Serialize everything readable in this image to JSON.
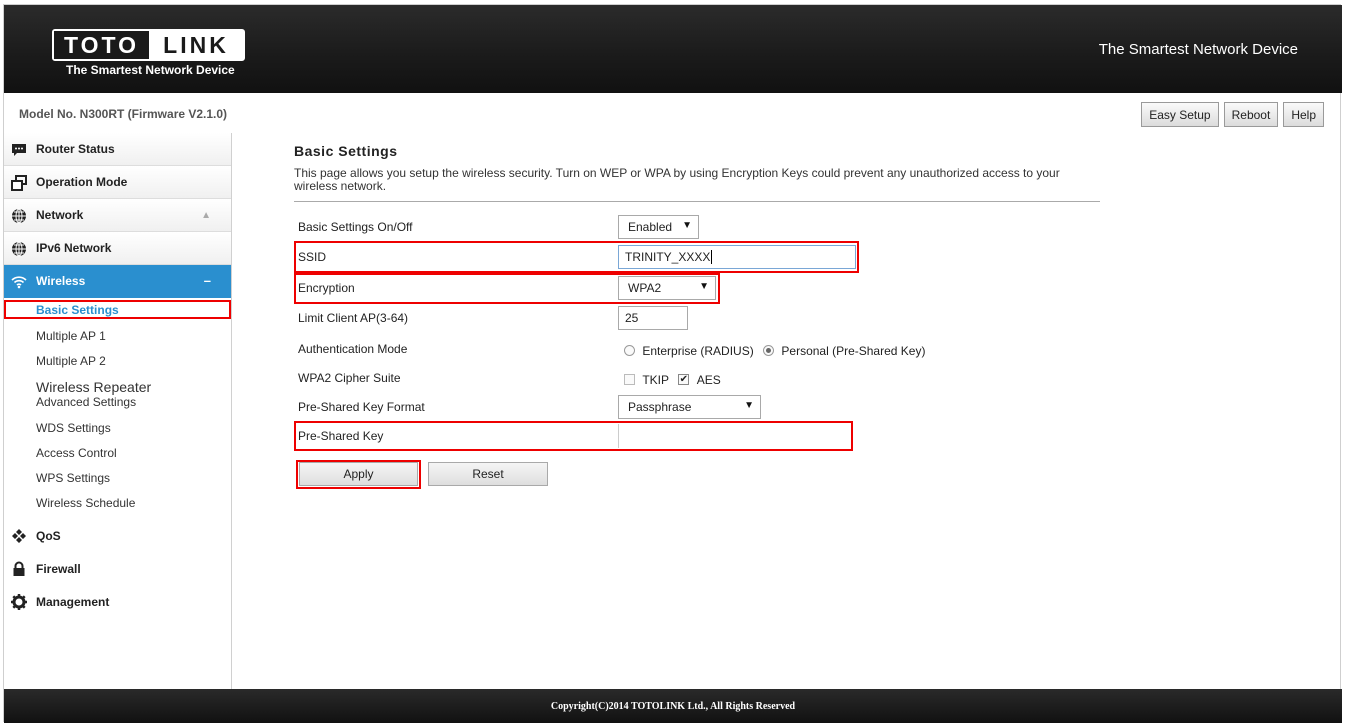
{
  "header": {
    "logo_left": "TOTO",
    "logo_right": "LINK",
    "logo_tagline": "The Smartest Network Device",
    "tagline": "The Smartest Network Device"
  },
  "subheader": {
    "model": "Model No. N300RT (Firmware V2.1.0)",
    "buttons": {
      "easy_setup": "Easy Setup",
      "reboot": "Reboot",
      "help": "Help"
    }
  },
  "sidebar": {
    "router_status": "Router Status",
    "operation_mode": "Operation Mode",
    "network": "Network",
    "ipv6_network": "IPv6 Network",
    "wireless": "Wireless",
    "wireless_sub": {
      "basic_settings": "Basic Settings",
      "multiple_ap1": "Multiple AP 1",
      "multiple_ap2": "Multiple AP 2",
      "wireless_repeater": "Wireless Repeater",
      "advanced_settings": "Advanced Settings",
      "wds_settings": "WDS Settings",
      "access_control": "Access Control",
      "wps_settings": "WPS Settings",
      "wireless_schedule": "Wireless Schedule"
    },
    "qos": "QoS",
    "firewall": "Firewall",
    "management": "Management"
  },
  "main": {
    "title": "Basic Settings",
    "description": "This page allows you setup the wireless security. Turn on WEP or WPA by using Encryption Keys could prevent any unauthorized access to your wireless network.",
    "fields": {
      "onoff_label": "Basic Settings On/Off",
      "onoff_value": "Enabled",
      "ssid_label": "SSID",
      "ssid_value": "TRINITY_XXXX",
      "encryption_label": "Encryption",
      "encryption_value": "WPA2",
      "limit_label": "Limit Client AP(3-64)",
      "limit_value": "25",
      "auth_label": "Authentication Mode",
      "auth_enterprise": "Enterprise (RADIUS)",
      "auth_personal": "Personal (Pre-Shared Key)",
      "cipher_label": "WPA2 Cipher Suite",
      "cipher_tkip": "TKIP",
      "cipher_aes": "AES",
      "psk_format_label": "Pre-Shared Key Format",
      "psk_format_value": "Passphrase",
      "psk_label": "Pre-Shared Key",
      "psk_value": ""
    },
    "apply": "Apply",
    "reset": "Reset"
  },
  "footer": {
    "copyright": "Copyright(C)2014 TOTOLINK Ltd., All Rights Reserved"
  },
  "colors": {
    "accent": "#2a8fcf",
    "highlight": "#e00000",
    "header_bg": "#1a1a1a"
  }
}
